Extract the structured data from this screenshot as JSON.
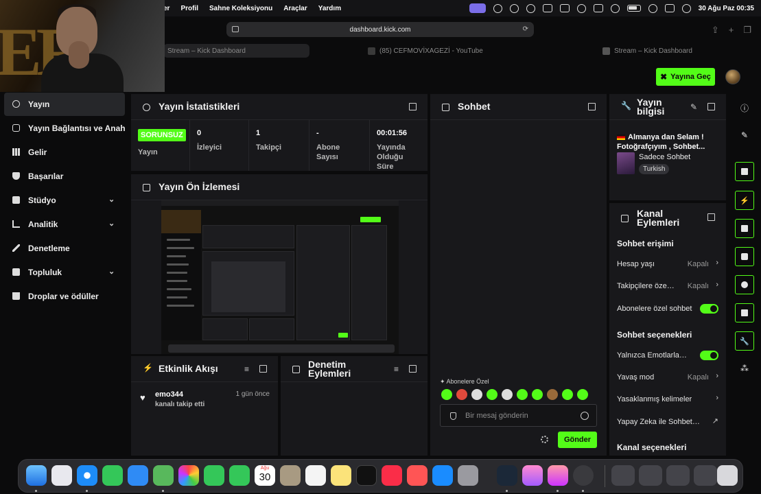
{
  "menubar": {
    "items": [
      "er",
      "Profil",
      "Sahne Koleksiyonu",
      "Araçlar",
      "Yardım"
    ],
    "datetime": "30 Ağu Paz  00:35"
  },
  "browser": {
    "url": "dashboard.kick.com",
    "tabs": [
      {
        "label": "Stream – Kick Dashboard"
      },
      {
        "label": "(85) CEFMOVİXAGEZİ - YouTube"
      },
      {
        "label": "Stream – Kick Dashboard"
      }
    ]
  },
  "header": {
    "go_live": "Yayına Geç"
  },
  "nav": {
    "items": [
      {
        "label": "Yayın"
      },
      {
        "label": "Yayın Bağlantısı ve Anah"
      },
      {
        "label": "Gelir"
      },
      {
        "label": "Başarılar"
      },
      {
        "label": "Stüdyo"
      },
      {
        "label": "Analitik"
      },
      {
        "label": "Denetleme"
      },
      {
        "label": "Topluluk"
      },
      {
        "label": "Droplar ve ödüller"
      }
    ]
  },
  "stats": {
    "title": "Yayın İstatistikleri",
    "cells": [
      {
        "value": "SORUNSUZ",
        "label": "Yayın"
      },
      {
        "value": "0",
        "label": "İzleyici"
      },
      {
        "value": "1",
        "label": "Takipçi"
      },
      {
        "value": "-",
        "label": "Abone Sayısı"
      },
      {
        "value": "00:01:56",
        "label": "Yayında Olduğu Süre"
      }
    ]
  },
  "preview": {
    "title": "Yayın Ön İzlemesi"
  },
  "activity": {
    "title": "Etkinlik Akışı",
    "events": [
      {
        "user": "emo344",
        "time": "1 gün önce",
        "desc": "kanalı takip etti"
      }
    ]
  },
  "moderation": {
    "title": "Denetim Eylemleri"
  },
  "chat": {
    "title": "Sohbet",
    "sub_only": "Abonelere Özel",
    "placeholder": "Bir mesaj gönderin",
    "send": "Gönder"
  },
  "stream_info": {
    "title": "Yayın bilgisi",
    "stream_title": "Almanya dan Selam ! Fotoğrafçıyım , Sohbet...",
    "category": "Sadece Sohbet",
    "language": "Turkish"
  },
  "channel_actions": {
    "title": "Kanal Eylemleri",
    "chat_access": "Sohbet erişimi",
    "account_age": {
      "label": "Hesap yaşı",
      "value": "Kapalı"
    },
    "followers": {
      "label": "Takipçilere öze…",
      "value": "Kapalı"
    },
    "subs_only": {
      "label": "Abonelere özel sohbet"
    },
    "chat_options": "Sohbet seçenekleri",
    "emotes_only": {
      "label": "Yalnızca Emotlarla…"
    },
    "slow_mode": {
      "label": "Yavaş mod",
      "value": "Kapalı"
    },
    "banned_words": {
      "label": "Yasaklanmış kelimeler"
    },
    "ai_chat": {
      "label": "Yapay Zeka ile Sohbet…"
    },
    "channel_options": "Kanal seçenekleri"
  },
  "dock": {
    "calendar_month": "Ağu",
    "calendar_day": "30"
  },
  "colors": {
    "accent": "#53fc18",
    "panel": "#18181b",
    "bg": "#0b0b0c"
  }
}
